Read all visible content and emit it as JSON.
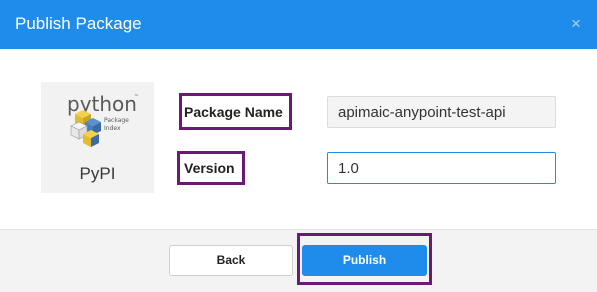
{
  "dialog": {
    "title": "Publish Package",
    "close_glyph": "×"
  },
  "logo": {
    "wordmark": "python",
    "trademark": "™",
    "subtitle_line1": "Package",
    "subtitle_line2": "Index",
    "caption": "PyPI"
  },
  "form": {
    "package_name_label": "Package Name",
    "package_name_value": "apimaic-anypoint-test-api",
    "version_label": "Version",
    "version_value": "1.0"
  },
  "footer": {
    "back_label": "Back",
    "publish_label": "Publish"
  },
  "colors": {
    "header": "#1f8ceb",
    "primary_button": "#1f8ceb",
    "highlight": "#6a1a75"
  }
}
